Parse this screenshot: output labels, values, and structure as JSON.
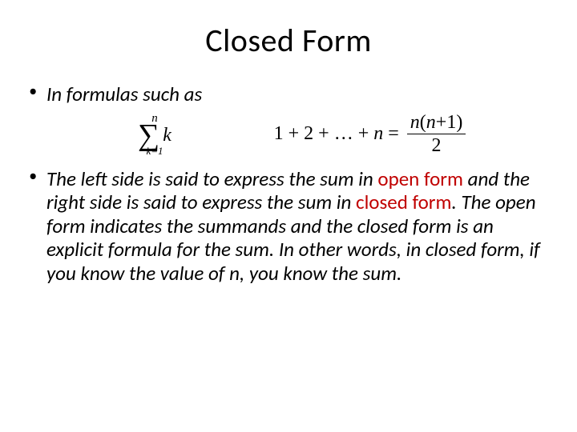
{
  "title": "Closed Form",
  "bullet1": "In formulas such as",
  "formula": {
    "sigma_top": "n",
    "sigma_bottom": "k=1",
    "sigma_var": "k",
    "eq_lhs_pre": "1 + 2 + … + ",
    "eq_lhs_n": "n",
    "eq_equals": " = ",
    "frac_num_pre": "n",
    "frac_num_paren_open": "(",
    "frac_num_n": "n",
    "frac_num_rest": "+1)",
    "frac_den": "2"
  },
  "bullet2": {
    "part1": "The left side is said to express the sum in ",
    "open_form": "open form",
    "part2": " and the right side is said to express the sum in ",
    "closed_form": "closed form",
    "part3": ".  The open form indicates the summands and the closed form is an explicit formula for the sum.  In other words, in closed form, if you know the value of n, you know the sum."
  }
}
